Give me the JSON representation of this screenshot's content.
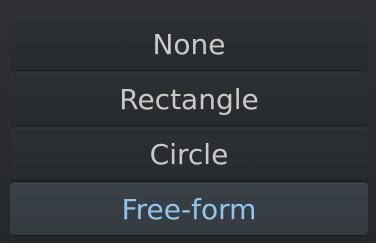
{
  "menu": {
    "items": [
      {
        "label": "None"
      },
      {
        "label": "Rectangle"
      },
      {
        "label": "Circle"
      },
      {
        "label": "Free-form"
      }
    ],
    "selected_label": "Free-form"
  },
  "colors": {
    "background": "#2a2c2f",
    "item_text": "#c9c9c9",
    "selected_text": "#8fc5ee",
    "selected_background": "#3b4148"
  }
}
